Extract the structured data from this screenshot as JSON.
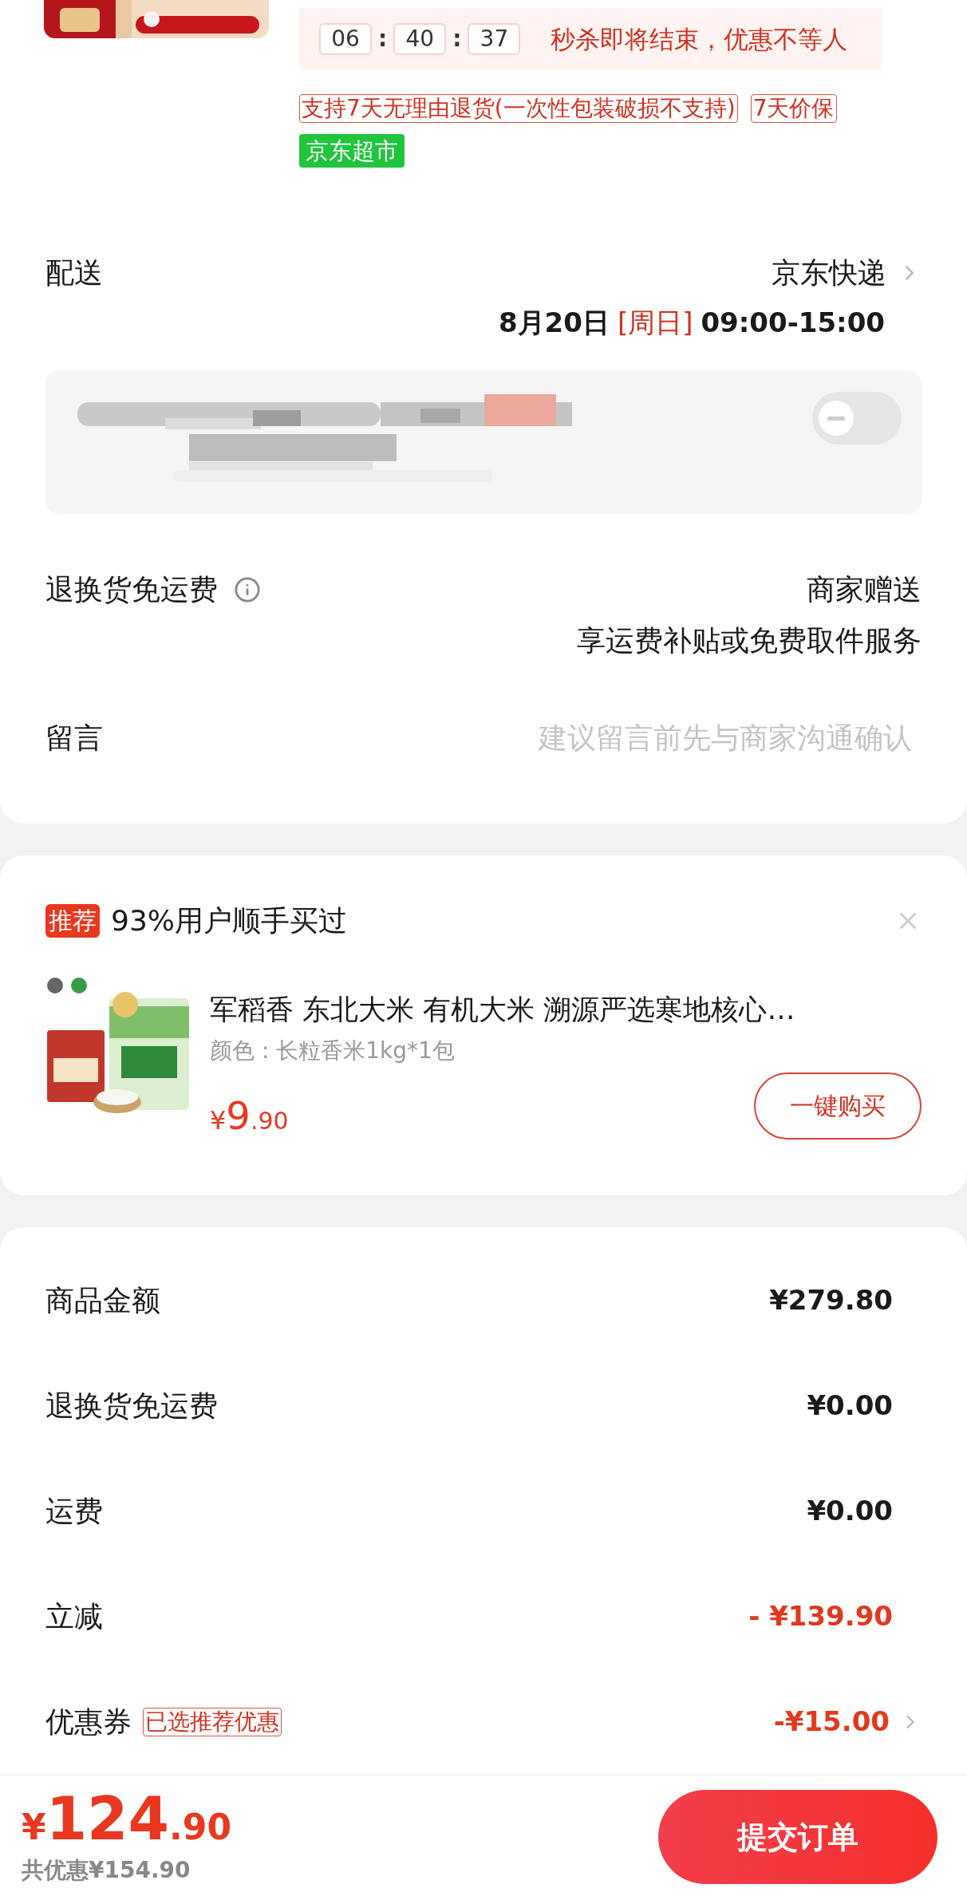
{
  "timer": {
    "hours": "06",
    "minutes": "40",
    "seconds": "37",
    "separator": ":",
    "message": "秒杀即将结束，优惠不等人"
  },
  "tags": [
    {
      "label": "支持7天无理由退货(一次性包装破损不支持)",
      "kind": "outline"
    },
    {
      "label": "7天价保",
      "kind": "outline"
    },
    {
      "label": "京东超市",
      "kind": "solid"
    }
  ],
  "delivery": {
    "label": "配送",
    "carrier": "京东快递",
    "date": "8月20日",
    "weekday": "[周日]",
    "time": "09:00-15:00"
  },
  "address": {
    "toggle_on": false
  },
  "return_shipping": {
    "label": "退换货免运费",
    "value": "商家赠送",
    "note": "享运费补贴或免费取件服务"
  },
  "message": {
    "label": "留言",
    "placeholder": "建议留言前先与商家沟通确认"
  },
  "recommendation": {
    "badge": "推荐",
    "title": "93%用户顺手买过",
    "product": {
      "name": "军稻香  东北大米 有机大米 溯源严选寒地核心…",
      "variant": "颜色 : 长粒香米1kg*1包",
      "currency": "¥",
      "price_int": "9",
      "price_dec": ".90"
    },
    "button": "一键购买"
  },
  "summary": [
    {
      "label": "商品金额",
      "value": "¥279.80",
      "kind": "plain"
    },
    {
      "label": "退换货免运费",
      "value": "¥0.00",
      "kind": "plain"
    },
    {
      "label": "运费",
      "value": "¥0.00",
      "kind": "plain"
    },
    {
      "label": "立减",
      "value": "- ¥139.90",
      "kind": "discount"
    },
    {
      "label": "优惠券",
      "tag": "已选推荐优惠",
      "value": "-¥15.00",
      "kind": "discount"
    }
  ],
  "footer": {
    "currency": "¥",
    "total_int": "124",
    "total_dec": ".90",
    "savings": "共优惠¥154.90",
    "submit": "提交订单"
  }
}
